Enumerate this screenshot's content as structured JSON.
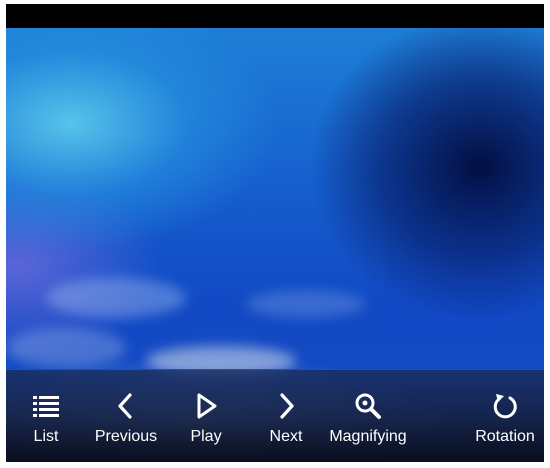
{
  "toolbar": {
    "buttons": [
      {
        "id": "list",
        "label": "List",
        "icon": "list-icon"
      },
      {
        "id": "previous",
        "label": "Previous",
        "icon": "chevron-left-icon"
      },
      {
        "id": "play",
        "label": "Play",
        "icon": "play-icon"
      },
      {
        "id": "next",
        "label": "Next",
        "icon": "chevron-right-icon"
      },
      {
        "id": "magnifying",
        "label": "Magnifying",
        "icon": "magnifier-icon"
      },
      {
        "id": "rotation",
        "label": "Rotation",
        "icon": "rotate-icon"
      }
    ]
  },
  "colors": {
    "icon": "#ffffff",
    "label": "#ffffff",
    "toolbar_background": "#141e3c",
    "sky_blue": "#1660cf"
  }
}
